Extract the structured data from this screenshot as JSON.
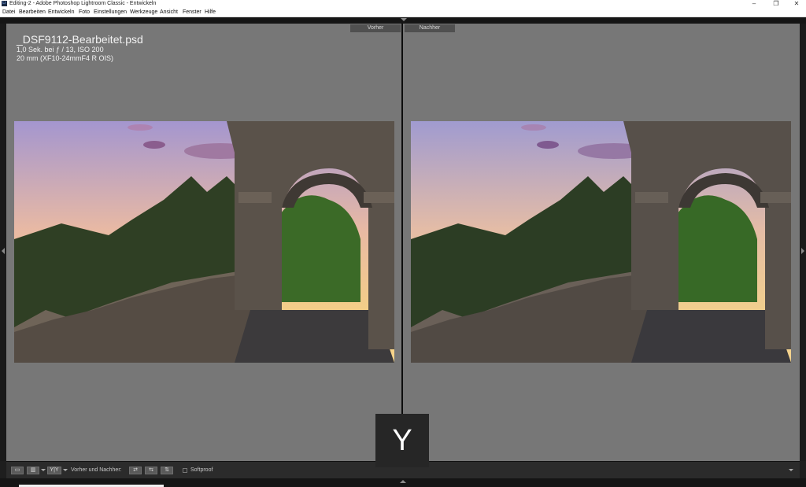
{
  "window": {
    "title": "Editing-2 - Adobe Photoshop Lightroom Classic - Entwickeln",
    "app_icon": "Lr"
  },
  "window_controls": {
    "minimize": "–",
    "maximize": "❐",
    "close": "✕"
  },
  "menu": [
    "Datei",
    "Bearbeiten",
    "Entwickeln",
    "Foto",
    "Einstellungen",
    "Werkzeuge",
    "Ansicht",
    "Fenster",
    "Hilfe"
  ],
  "view": {
    "before_label": "Vorher",
    "after_label": "Nachher"
  },
  "photo_info": {
    "filename": "_DSF9112-Bearbeitet.psd",
    "exposure": "1,0 Sek. bei ƒ / 13, ISO 200",
    "lens": "20 mm (XF10-24mmF4 R OIS)"
  },
  "toolbar": {
    "view_mode_yy": "Y|Y",
    "before_after_label": "Vorher und Nachher:",
    "softproof_label": "Softproof",
    "softproof_checked": false
  },
  "overlay_key": "Y",
  "colors": {
    "workspace_bg": "#777777",
    "toolbar_bg": "#2b2b2b"
  },
  "icons": [
    "loupe-view-icon",
    "grid-view-icon",
    "before-after-icon",
    "copy-before-to-after-icon",
    "swap-icon",
    "copy-after-to-before-icon",
    "panel-toggle-icon"
  ]
}
